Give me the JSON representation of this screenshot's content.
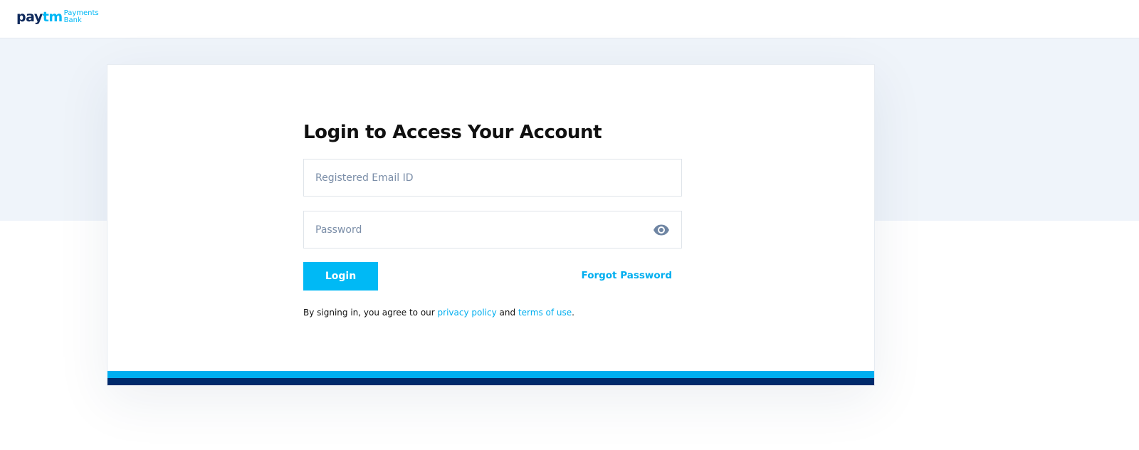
{
  "brand": {
    "logo_pay": "pay",
    "logo_tm": "tm",
    "logo_sub_line1": "Payments",
    "logo_sub_line2": "Bank",
    "primary_color": "#00b9f5",
    "navy_color": "#0f2a5c"
  },
  "login": {
    "title": "Login to Access Your Account",
    "email_placeholder": "Registered Email ID",
    "email_value": "",
    "password_placeholder": "Password",
    "password_value": "",
    "login_button": "Login",
    "forgot_password": "Forgot Password",
    "terms_prefix": "By signing in, you agree to our ",
    "privacy_link": "privacy policy",
    "terms_and": " and ",
    "terms_link": "terms of use",
    "terms_suffix": "."
  },
  "icons": {
    "password_toggle": "eye-icon"
  }
}
